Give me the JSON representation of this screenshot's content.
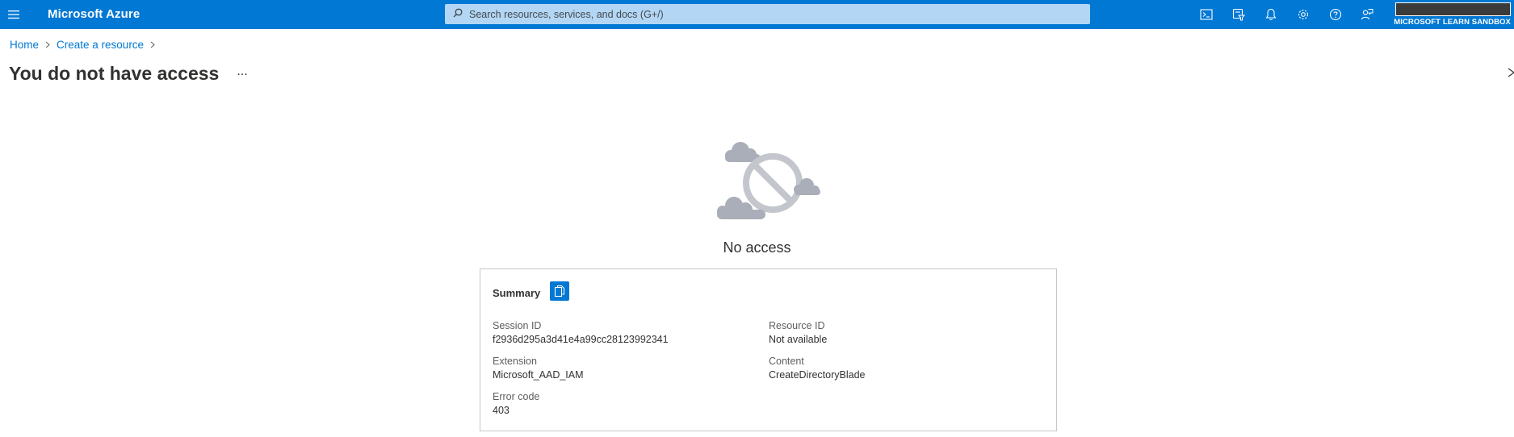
{
  "header": {
    "brand": "Microsoft Azure",
    "search_placeholder": "Search resources, services, and docs (G+/)",
    "icons": [
      "hamburger-menu-icon",
      "cloud-shell-icon",
      "directory-filter-icon",
      "notifications-bell-icon",
      "settings-gear-icon",
      "help-question-icon",
      "feedback-icon"
    ],
    "account": {
      "directory": "MICROSOFT LEARN SANDBOX"
    },
    "color": "#0078d4"
  },
  "breadcrumb": {
    "items": [
      "Home",
      "Create a resource"
    ]
  },
  "page": {
    "title": "You do not have access",
    "more": "...",
    "illustration": "no-access-cloud-icon",
    "message": "No access"
  },
  "summary": {
    "title": "Summary",
    "fields": [
      {
        "key": "Session ID",
        "value": "f2936d295a3d41e4a99cc28123992341"
      },
      {
        "key": "Resource ID",
        "value": "Not available"
      },
      {
        "key": "Extension",
        "value": "Microsoft_AAD_IAM"
      },
      {
        "key": "Content",
        "value": "CreateDirectoryBlade"
      },
      {
        "key": "Error code",
        "value": "403"
      }
    ]
  }
}
